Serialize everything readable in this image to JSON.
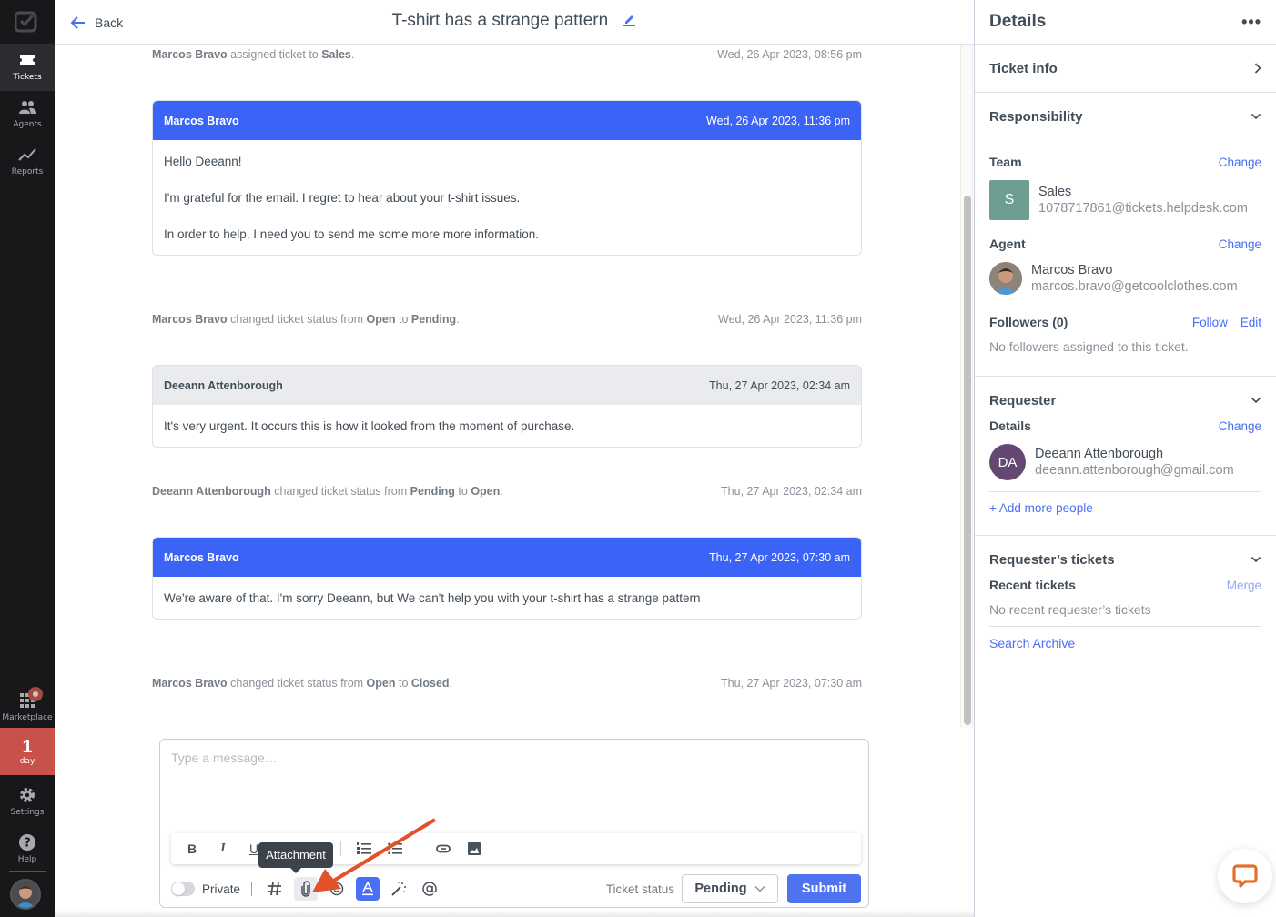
{
  "nav": {
    "items": [
      {
        "label": "Tickets",
        "icon": "ticket-icon",
        "active": true
      },
      {
        "label": "Agents",
        "icon": "agents-icon"
      },
      {
        "label": "Reports",
        "icon": "reports-icon"
      },
      {
        "label": "Marketplace",
        "icon": "apps-grid-icon"
      },
      {
        "label": "Settings",
        "icon": "gear-icon"
      },
      {
        "label": "Help",
        "icon": "help-icon"
      }
    ],
    "trial": {
      "number": "1",
      "unit": "day"
    }
  },
  "header": {
    "back_label": "Back",
    "title": "T-shirt has a strange pattern"
  },
  "conversation": {
    "events": [
      {
        "actor": "Marcos Bravo",
        "text_before": " assigned ticket to ",
        "target": "Sales",
        "text_after": ".",
        "time": "Wed, 26 Apr 2023, 08:56 pm"
      },
      {
        "actor": "Marcos Bravo",
        "text_before": " changed ticket status from ",
        "from": "Open",
        "mid": " to ",
        "to": "Pending",
        "text_after": ".",
        "time": "Wed, 26 Apr 2023, 11:36 pm"
      },
      {
        "actor": "Deeann Attenborough",
        "text_before": " changed ticket status from ",
        "from": "Pending",
        "mid": " to ",
        "to": "Open",
        "text_after": ".",
        "time": "Thu, 27 Apr 2023, 02:34 am"
      },
      {
        "actor": "Marcos Bravo",
        "text_before": " changed ticket status from ",
        "from": "Open",
        "mid": " to ",
        "to": "Closed",
        "text_after": ".",
        "time": "Thu, 27 Apr 2023, 07:30 am"
      }
    ],
    "messages": [
      {
        "author": "Marcos Bravo",
        "time": "Wed, 26 Apr 2023, 11:36 pm",
        "type": "agent",
        "paragraphs": [
          "Hello Deeann!",
          "I'm grateful for the email. I regret to hear about your t-shirt issues.",
          "In order to help, I need you to send me some more more information."
        ]
      },
      {
        "author": "Deeann Attenborough",
        "time": "Thu, 27 Apr 2023, 02:34 am",
        "type": "customer",
        "paragraphs": [
          "It's very urgent. It occurs this is how it looked from the moment of purchase."
        ]
      },
      {
        "author": "Marcos Bravo",
        "time": "Thu, 27 Apr 2023, 07:30 am",
        "type": "agent",
        "paragraphs": [
          "We're aware of that. I'm sorry Deeann, but We can't help you with your t-shirt has a strange pattern"
        ]
      }
    ]
  },
  "composer": {
    "placeholder": "Type a message…",
    "format_buttons": [
      "B",
      "I",
      "U"
    ],
    "private_label": "Private",
    "tooltip": "Attachment",
    "status_label": "Ticket status",
    "status_value": "Pending",
    "submit_label": "Submit"
  },
  "details": {
    "title": "Details",
    "ticket_info": "Ticket info",
    "responsibility": {
      "title": "Responsibility",
      "team_label": "Team",
      "team_change": "Change",
      "team_initial": "S",
      "team_name": "Sales",
      "team_email": "1078717861@tickets.helpdesk.com",
      "agent_label": "Agent",
      "agent_change": "Change",
      "agent_name": "Marcos Bravo",
      "agent_email": "marcos.bravo@getcoolclothes.com",
      "followers_label": "Followers (0)",
      "follow": "Follow",
      "edit": "Edit",
      "followers_empty": "No followers assigned to this ticket."
    },
    "requester": {
      "title": "Requester",
      "details_label": "Details",
      "change": "Change",
      "initials": "DA",
      "name": "Deeann Attenborough",
      "email": "deeann.attenborough@gmail.com",
      "add_people": "+ Add more people"
    },
    "requester_tickets": {
      "title": "Requester’s tickets",
      "recent_label": "Recent tickets",
      "merge": "Merge",
      "empty": "No recent requester’s tickets",
      "search_archive": "Search Archive"
    }
  },
  "colors": {
    "accent": "#3b63f6",
    "nav_bg": "#18181b",
    "trial_bg": "#c8524a",
    "annotation_arrow": "#e2522a",
    "chat_widget": "#e5702a"
  }
}
